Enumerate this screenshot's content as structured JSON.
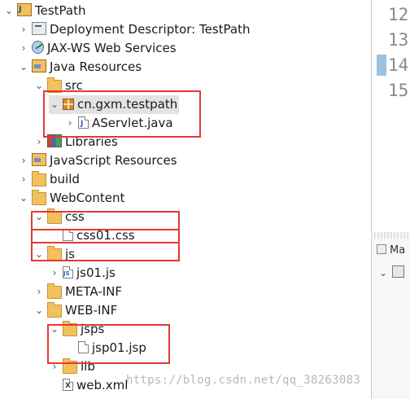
{
  "tree": [
    {
      "label": "TestPath",
      "toggle": "v",
      "icon": "project-icon"
    },
    {
      "label": "Deployment Descriptor: TestPath",
      "toggle": ">",
      "icon": "descriptor-icon"
    },
    {
      "label": "JAX-WS Web Services",
      "toggle": ">",
      "icon": "webservice-icon"
    },
    {
      "label": "Java Resources",
      "toggle": "v",
      "icon": "java-resources-icon"
    },
    {
      "label": "src",
      "toggle": "v",
      "icon": "folder-icon"
    },
    {
      "label": "cn.gxm.testpath",
      "toggle": "v",
      "icon": "package-icon"
    },
    {
      "label": "AServlet.java",
      "toggle": ">",
      "icon": "java-file-icon"
    },
    {
      "label": "Libraries",
      "toggle": ">",
      "icon": "libraries-icon"
    },
    {
      "label": "JavaScript Resources",
      "toggle": ">",
      "icon": "js-resources-icon"
    },
    {
      "label": "build",
      "toggle": ">",
      "icon": "folder-icon"
    },
    {
      "label": "WebContent",
      "toggle": "v",
      "icon": "folder-icon"
    },
    {
      "label": "css",
      "toggle": "v",
      "icon": "folder-icon"
    },
    {
      "label": "css01.css",
      "toggle": "",
      "icon": "css-file-icon"
    },
    {
      "label": "js",
      "toggle": "v",
      "icon": "folder-icon"
    },
    {
      "label": "js01.js",
      "toggle": ">",
      "icon": "js-file-icon"
    },
    {
      "label": "META-INF",
      "toggle": ">",
      "icon": "folder-icon"
    },
    {
      "label": "WEB-INF",
      "toggle": "v",
      "icon": "folder-icon"
    },
    {
      "label": "jsps",
      "toggle": "v",
      "icon": "folder-icon"
    },
    {
      "label": "jsp01.jsp",
      "toggle": "",
      "icon": "jsp-file-icon"
    },
    {
      "label": "lib",
      "toggle": ">",
      "icon": "folder-icon"
    },
    {
      "label": "web.xml",
      "toggle": "",
      "icon": "xml-file-icon"
    }
  ],
  "editor": {
    "line_numbers": [
      "12",
      "13",
      "14",
      "15"
    ],
    "side_panel_tab": "Ma"
  },
  "watermark": "https://blog.csdn.net/qq_38263083",
  "colors": {
    "highlight": "#e53935",
    "selection": "#e3e3e3"
  }
}
